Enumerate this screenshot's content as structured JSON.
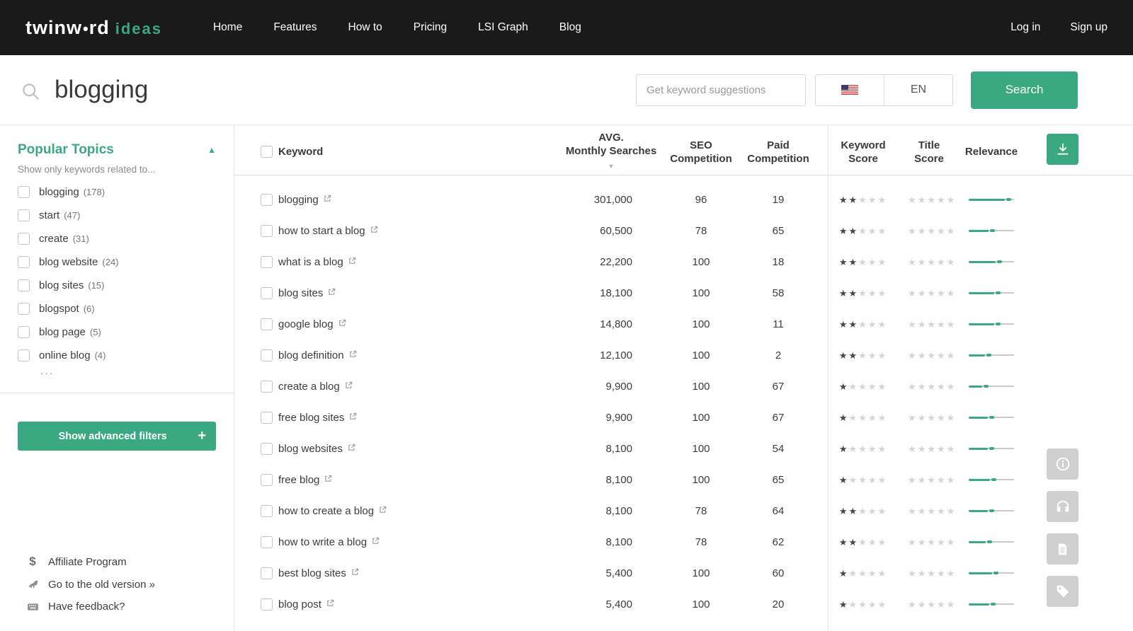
{
  "colors": {
    "accent_green": "#3aa981",
    "navbar_bg": "#1a1a1a",
    "star_filled": "#454545",
    "star_empty": "#d4d4d4",
    "relevance_track": "#c9c9c9"
  },
  "icons": {
    "star": "★",
    "collapse_arrow": "▲",
    "sort_arrow": "▼",
    "plus": "+",
    "dollar": "$"
  },
  "navbar": {
    "logo": {
      "part1": "twinw",
      "dot": "•",
      "part2": "rd",
      "suffix": "ideas"
    },
    "items": [
      "Home",
      "Features",
      "How to",
      "Pricing",
      "LSI Graph",
      "Blog"
    ],
    "login": "Log in",
    "signup": "Sign up"
  },
  "search": {
    "query": "blogging",
    "suggestions_placeholder": "Get keyword suggestions",
    "language_code": "EN",
    "search_button": "Search"
  },
  "sidebar": {
    "title": "Popular Topics",
    "subtitle": "Show only keywords related to...",
    "topics": [
      {
        "label": "blogging",
        "count": "(178)"
      },
      {
        "label": "start",
        "count": "(47)"
      },
      {
        "label": "create",
        "count": "(31)"
      },
      {
        "label": "blog website",
        "count": "(24)"
      },
      {
        "label": "blog sites",
        "count": "(15)"
      },
      {
        "label": "blogspot",
        "count": "(6)"
      },
      {
        "label": "blog page",
        "count": "(5)"
      },
      {
        "label": "online blog",
        "count": "(4)"
      }
    ],
    "more_indicator": "...",
    "advanced_filters_button": "Show advanced filters",
    "links": [
      {
        "label": "Affiliate Program",
        "icon": "dollar-icon"
      },
      {
        "label": "Go to the old version »",
        "icon": "dinosaur-icon"
      },
      {
        "label": "Have feedback?",
        "icon": "keyboard-icon"
      }
    ]
  },
  "table": {
    "headers": {
      "keyword": "Keyword",
      "avg_monthly_searches": [
        "AVG.",
        "Monthly Searches"
      ],
      "seo_competition": [
        "SEO",
        "Competition"
      ],
      "paid_competition": [
        "Paid",
        "Competition"
      ],
      "keyword_score": [
        "Keyword",
        "Score"
      ],
      "title_score": [
        "Title",
        "Score"
      ],
      "relevance": "Relevance"
    },
    "rows": [
      {
        "keyword": "blogging",
        "searches": "301,000",
        "seo": "96",
        "paid": "19",
        "keyword_score": 2,
        "title_score": 0,
        "relevance": 94
      },
      {
        "keyword": "how to start a blog",
        "searches": "60,500",
        "seo": "78",
        "paid": "65",
        "keyword_score": 2,
        "title_score": 0,
        "relevance": 58
      },
      {
        "keyword": "what is a blog",
        "searches": "22,200",
        "seo": "100",
        "paid": "18",
        "keyword_score": 2,
        "title_score": 0,
        "relevance": 73
      },
      {
        "keyword": "blog sites",
        "searches": "18,100",
        "seo": "100",
        "paid": "58",
        "keyword_score": 2,
        "title_score": 0,
        "relevance": 70
      },
      {
        "keyword": "google blog",
        "searches": "14,800",
        "seo": "100",
        "paid": "11",
        "keyword_score": 2,
        "title_score": 0,
        "relevance": 70
      },
      {
        "keyword": "blog definition",
        "searches": "12,100",
        "seo": "100",
        "paid": "2",
        "keyword_score": 2,
        "title_score": 0,
        "relevance": 50
      },
      {
        "keyword": "create a blog",
        "searches": "9,900",
        "seo": "100",
        "paid": "67",
        "keyword_score": 1,
        "title_score": 0,
        "relevance": 44
      },
      {
        "keyword": "free blog sites",
        "searches": "9,900",
        "seo": "100",
        "paid": "67",
        "keyword_score": 1,
        "title_score": 0,
        "relevance": 56
      },
      {
        "keyword": "blog websites",
        "searches": "8,100",
        "seo": "100",
        "paid": "54",
        "keyword_score": 1,
        "title_score": 0,
        "relevance": 56
      },
      {
        "keyword": "free blog",
        "searches": "8,100",
        "seo": "100",
        "paid": "65",
        "keyword_score": 1,
        "title_score": 0,
        "relevance": 61
      },
      {
        "keyword": "how to create a blog",
        "searches": "8,100",
        "seo": "78",
        "paid": "64",
        "keyword_score": 2,
        "title_score": 0,
        "relevance": 56
      },
      {
        "keyword": "how to write a blog",
        "searches": "8,100",
        "seo": "78",
        "paid": "62",
        "keyword_score": 2,
        "title_score": 0,
        "relevance": 52
      },
      {
        "keyword": "best blog sites",
        "searches": "5,400",
        "seo": "100",
        "paid": "60",
        "keyword_score": 1,
        "title_score": 0,
        "relevance": 66
      },
      {
        "keyword": "blog post",
        "searches": "5,400",
        "seo": "100",
        "paid": "20",
        "keyword_score": 1,
        "title_score": 0,
        "relevance": 60
      }
    ]
  }
}
